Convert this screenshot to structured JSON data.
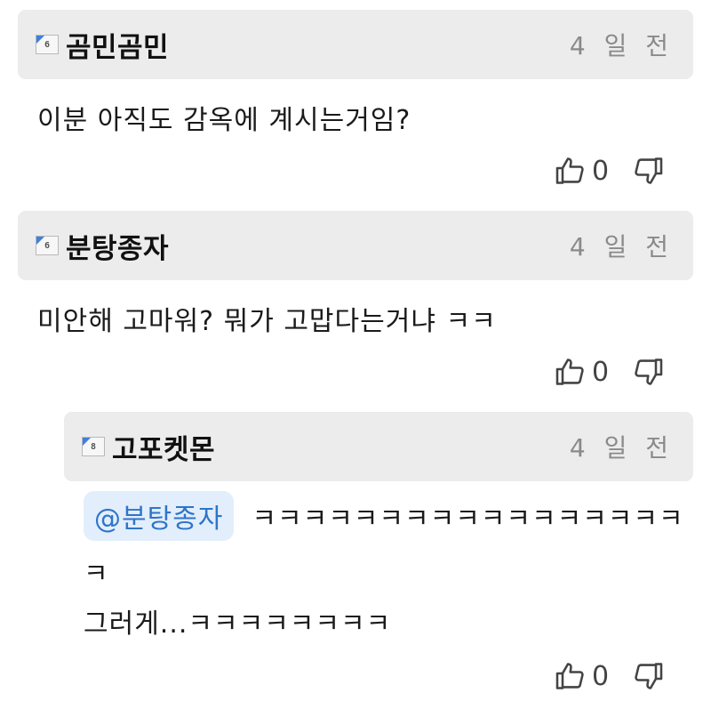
{
  "comments": [
    {
      "author": "곰민곰민",
      "level": "6",
      "time": "4 일 전",
      "text": "이분 아직도 감옥에 계시는거임?",
      "likes": "0"
    },
    {
      "author": "분탕종자",
      "level": "6",
      "time": "4 일 전",
      "text": "미안해 고마워? 뭐가 고맙다는거냐 ㅋㅋ",
      "likes": "0"
    },
    {
      "author": "고포켓몬",
      "level": "8",
      "time": "4 일 전",
      "mention": "@분탕종자",
      "text_line1": "ㅋㅋㅋㅋㅋㅋㅋㅋㅋㅋㅋㅋㅋㅋㅋㅋㅋ",
      "text_line2": "ㅋ",
      "text_line3": "그러게...ㅋㅋㅋㅋㅋㅋㅋㅋ",
      "likes": "0"
    }
  ],
  "icons": {
    "like": "thumbs-up-icon",
    "dislike": "thumbs-down-icon"
  },
  "colors": {
    "header_bg": "#ececec",
    "level_badge_accent": "#3f7fe0",
    "mention_bg": "#e2eefb",
    "mention_text": "#2f74c9"
  }
}
